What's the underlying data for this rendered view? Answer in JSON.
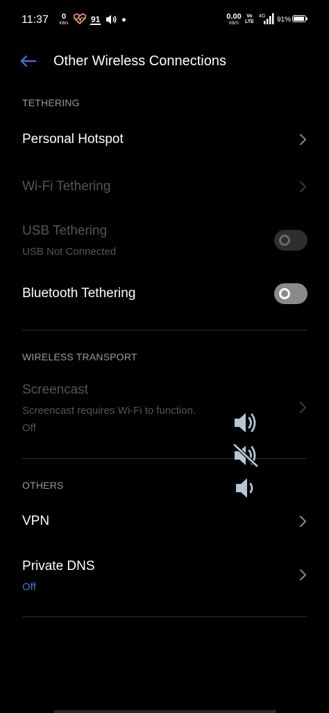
{
  "status_bar": {
    "time": "11:37",
    "speed_left": {
      "value": "0",
      "unit": "KB/s"
    },
    "notification_count": "91",
    "speed_right": {
      "value": "0.00",
      "unit": "KB/S"
    },
    "volte_top": "Vo",
    "volte_bottom": "LTE",
    "network_type": "4G",
    "battery_percent": "91%",
    "battery_level": 0.91
  },
  "header": {
    "title": "Other Wireless Connections",
    "back_icon": "back-arrow-icon",
    "accent_color": "#3f7ad6"
  },
  "sections": {
    "tethering": {
      "header": "TETHERING",
      "personal_hotspot": {
        "title": "Personal Hotspot"
      },
      "wifi_tethering": {
        "title": "Wi-Fi Tethering"
      },
      "usb_tethering": {
        "title": "USB Tethering",
        "subtitle": "USB Not Connected"
      },
      "bluetooth_tethering": {
        "title": "Bluetooth Tethering"
      }
    },
    "wireless_transport": {
      "header": "WIRELESS TRANSPORT",
      "screencast": {
        "title": "Screencast",
        "subtitle": "Screencast requires Wi-Fi to function.",
        "status": "Off"
      }
    },
    "others": {
      "header": "OTHERS",
      "vpn": {
        "title": "VPN"
      },
      "private_dns": {
        "title": "Private DNS",
        "status": "Off"
      }
    }
  },
  "volume_overlay": {
    "icons": [
      "volume-icon",
      "volume-muted-icon",
      "volume-low-icon"
    ]
  }
}
